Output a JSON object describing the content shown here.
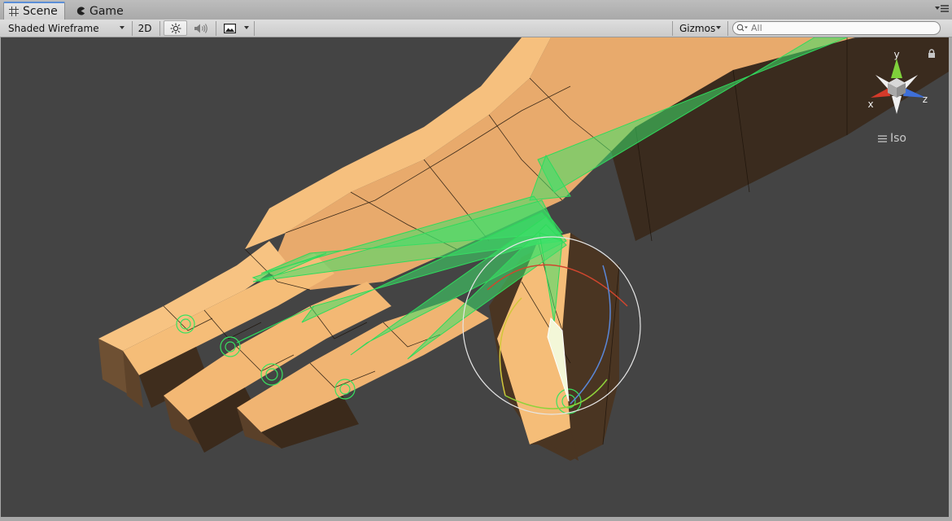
{
  "tabs": [
    {
      "label": "Scene",
      "icon": "grid-icon",
      "active": true
    },
    {
      "label": "Game",
      "icon": "pacman-icon",
      "active": false
    }
  ],
  "toolbar": {
    "draw_mode": "Shaded Wireframe",
    "mode_2d": "2D",
    "gizmos": "Gizmos",
    "search_placeholder": "All"
  },
  "gizmo": {
    "axis_x": "x",
    "axis_y": "y",
    "axis_z": "z",
    "projection": "Iso",
    "colors": {
      "x": "#d63a2a",
      "y": "#7fd13b",
      "z": "#3e6fd8"
    }
  },
  "colors": {
    "viewport_bg": "#444444",
    "mesh_light": "#f5bd78",
    "mesh_dark": "#3a2a1c",
    "bone": "#3ee06a",
    "selection_outline": "#e8e8e8"
  }
}
